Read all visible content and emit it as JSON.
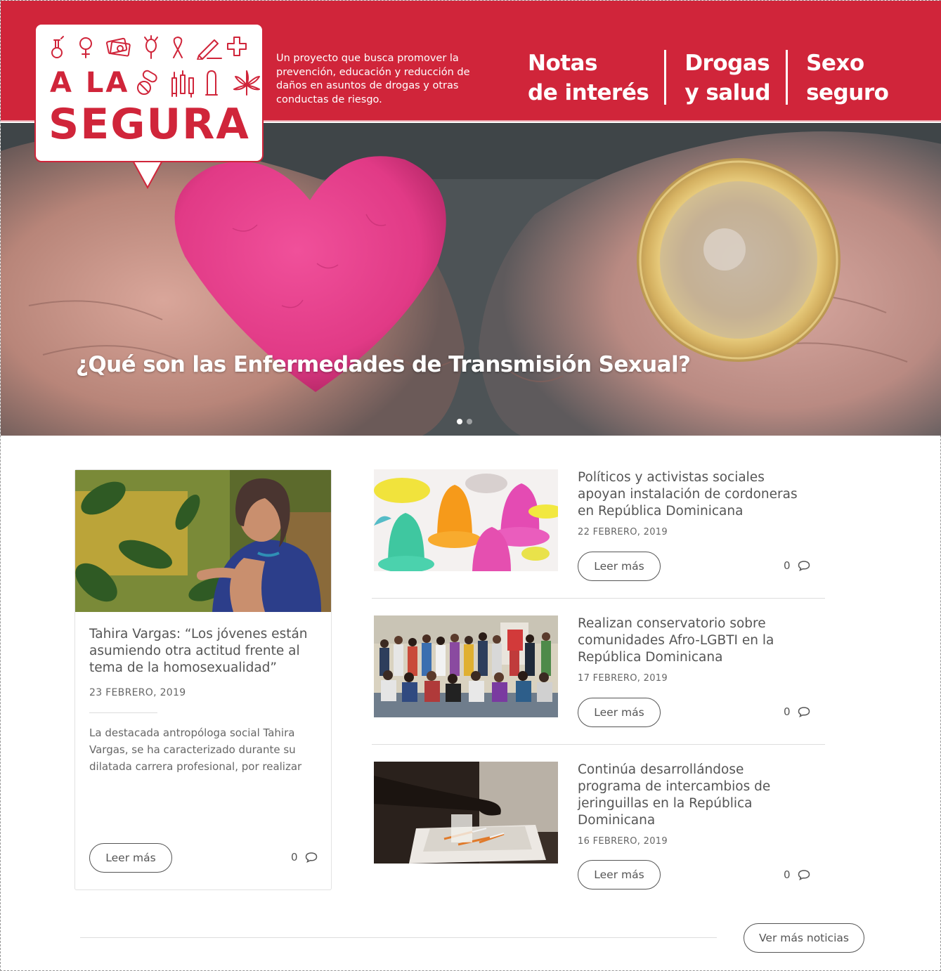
{
  "brand": {
    "logo_line1": "A LA",
    "logo_line2": "SEGURA",
    "tagline": "Un proyecto que busca promover la prevención, educación y reducción de daños en asuntos de drogas y otras conductas de riesgo.",
    "primary_color": "#d0253a"
  },
  "nav": {
    "items": [
      {
        "label": "Notas\nde interés"
      },
      {
        "label": "Drogas\ny salud"
      },
      {
        "label": "Sexo\nseguro"
      }
    ]
  },
  "hero": {
    "title": "¿Qué son las Enfermedades de Transmisión Sexual?",
    "slides": 2,
    "active_slide": 1
  },
  "featured": {
    "title": "Tahira Vargas: “Los jóvenes están asumiendo otra actitud frente al tema de la homosexualidad”",
    "date": "23 FEBRERO, 2019",
    "excerpt": "La destacada antropóloga social Tahira Vargas, se ha caracterizado durante su dilatada carrera profesional, por realizar",
    "read_more": "Leer más",
    "comments": "0"
  },
  "articles": [
    {
      "title": "Políticos y activistas sociales apoyan instalación de cordoneras en República Dominicana",
      "date": "22 FEBRERO, 2019",
      "read_more": "Leer más",
      "comments": "0"
    },
    {
      "title": "Realizan conservatorio sobre comunidades Afro-LGBTI en la República Dominicana",
      "date": "17 FEBRERO, 2019",
      "read_more": "Leer más",
      "comments": "0"
    },
    {
      "title": "Continúa desarrollándose programa de intercambios de jeringuillas en la República Dominicana",
      "date": "16 FEBRERO, 2019",
      "read_more": "Leer más",
      "comments": "0"
    }
  ],
  "more_news": "Ver más noticias",
  "icons": [
    "flask-icon",
    "female-icon",
    "money-icon",
    "poppy-icon",
    "ribbon-icon",
    "pencil-icon",
    "medical-cross-icon",
    "pills-icon",
    "syringe-icon",
    "condom-icon",
    "cannabis-icon",
    "comment-icon"
  ]
}
